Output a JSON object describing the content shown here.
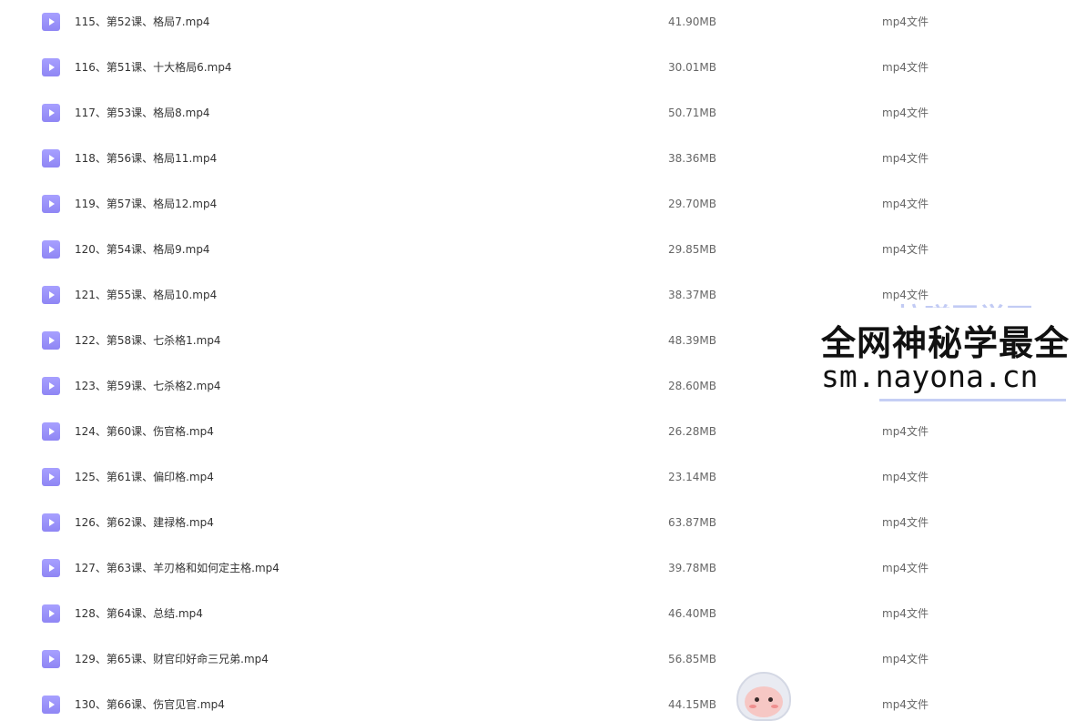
{
  "file_list": {
    "rows": [
      {
        "name": "115、第52课、格局7.mp4",
        "size": "41.90MB",
        "type": "mp4文件"
      },
      {
        "name": "116、第51课、十大格局6.mp4",
        "size": "30.01MB",
        "type": "mp4文件"
      },
      {
        "name": "117、第53课、格局8.mp4",
        "size": "50.71MB",
        "type": "mp4文件"
      },
      {
        "name": "118、第56课、格局11.mp4",
        "size": "38.36MB",
        "type": "mp4文件"
      },
      {
        "name": "119、第57课、格局12.mp4",
        "size": "29.70MB",
        "type": "mp4文件"
      },
      {
        "name": "120、第54课、格局9.mp4",
        "size": "29.85MB",
        "type": "mp4文件"
      },
      {
        "name": "121、第55课、格局10.mp4",
        "size": "38.37MB",
        "type": "mp4文件"
      },
      {
        "name": "122、第58课、七杀格1.mp4",
        "size": "48.39MB",
        "type": "mp4文件"
      },
      {
        "name": "123、第59课、七杀格2.mp4",
        "size": "28.60MB",
        "type": "mp4文件"
      },
      {
        "name": "124、第60课、伤官格.mp4",
        "size": "26.28MB",
        "type": "mp4文件"
      },
      {
        "name": "125、第61课、偏印格.mp4",
        "size": "23.14MB",
        "type": "mp4文件"
      },
      {
        "name": "126、第62课、建禄格.mp4",
        "size": "63.87MB",
        "type": "mp4文件"
      },
      {
        "name": "127、第63课、羊刃格和如何定主格.mp4",
        "size": "39.78MB",
        "type": "mp4文件"
      },
      {
        "name": "128、第64课、总结.mp4",
        "size": "46.40MB",
        "type": "mp4文件"
      },
      {
        "name": "129、第65课、财官印好命三兄弟.mp4",
        "size": "56.85MB",
        "type": "mp4文件"
      },
      {
        "name": "130、第66课、伤官见官.mp4",
        "size": "44.15MB",
        "type": "mp4文件"
      }
    ],
    "file_icon": "video-file-icon",
    "icon_color": "#9d95fb"
  },
  "watermark": {
    "background_text": "拉曦国学网",
    "line1": "全网神秘学最全",
    "line2": "sm.nayona.cn"
  },
  "mascot": {
    "icon": "mascot-icon"
  }
}
